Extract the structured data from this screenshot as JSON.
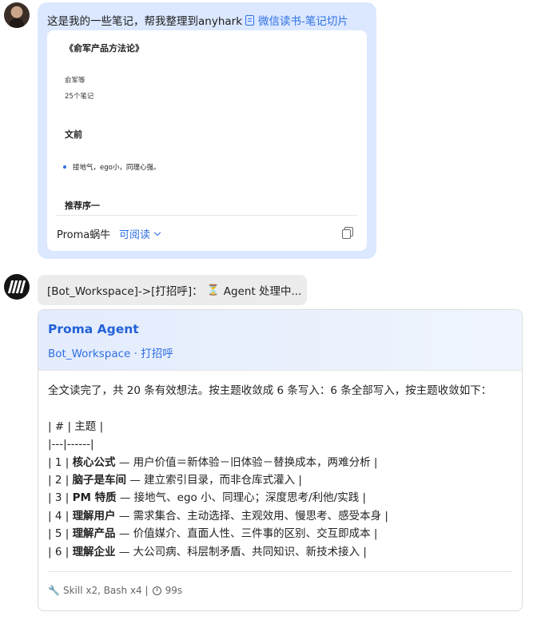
{
  "user_message": {
    "text": "这是我的一些笔记，帮我整理到anyhark",
    "link_text": "微信读书-笔记切片",
    "icons": {
      "avatar": "user-avatar-photo",
      "link": "document-icon"
    }
  },
  "note_card": {
    "book_title": "《俞军产品方法论》",
    "author": "俞军等",
    "note_count": "25个笔记",
    "section_1": "文前",
    "bullet_1": "接地气，ego小，同理心强。",
    "section_2": "推荐序一",
    "source": "Proma蜗牛",
    "readable": "可阅读",
    "icons": {
      "readable": "chevron-down-icon",
      "copy": "copy-icon"
    }
  },
  "status": {
    "prefix": "[Bot_Workspace]->[打招呼]：",
    "hourglass": "⏳",
    "suffix": "Agent 处理中..."
  },
  "agent_reply": {
    "title": "Proma Agent",
    "subtitle": "Bot_Workspace · 打招呼",
    "intro": "全文读完了，共 20 条有效想法。按主题收敛成 6 条写入：6 条全部写入，按主题收敛如下：",
    "table_header": "| # | 主题 |",
    "table_sep": "|---|------|",
    "rows": [
      {
        "idx": "| 1 | ",
        "term": "核心公式",
        "desc": " — 用户价值＝新体验－旧体验－替换成本，两难分析 |"
      },
      {
        "idx": "| 2 | ",
        "term": "脑子是车间",
        "desc": " — 建立索引目录，而非仓库式灌入 |"
      },
      {
        "idx": "| 3 | ",
        "term": "PM 特质",
        "desc": " — 接地气、ego 小、同理心；深度思考/利他/实践 |"
      },
      {
        "idx": "| 4 | ",
        "term": "理解用户",
        "desc": " — 需求集合、主动选择、主观效用、慢思考、感受本身 |"
      },
      {
        "idx": "| 5 | ",
        "term": "理解产品",
        "desc": " — 价值媒介、直面人性、三件事的区别、交互即成本 |"
      },
      {
        "idx": "| 6 | ",
        "term": "理解企业",
        "desc": " — 大公司病、科层制矛盾、共同知识、新技术接入 |"
      }
    ],
    "footer": {
      "tools": "Skill x2, Bash x4 |",
      "duration": "99s"
    },
    "icons": {
      "tools": "wrench-icon",
      "duration": "stopwatch-icon",
      "bot_avatar": "proma-logo"
    }
  },
  "colors": {
    "accent": "#2f6fe4",
    "user_bubble": "#dbe8ff",
    "status_pill": "#ececec"
  }
}
